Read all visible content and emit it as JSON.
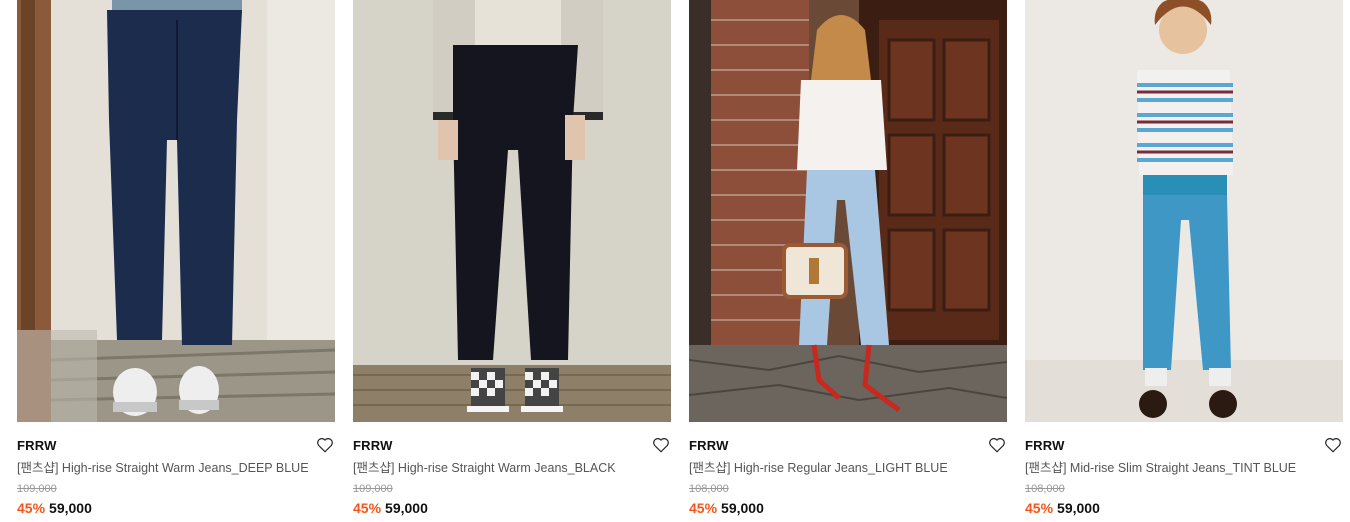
{
  "products": [
    {
      "brand": "FRRW",
      "name": "[팬츠샵] High-rise Straight Warm Jeans_DEEP BLUE",
      "original_price": "109,000",
      "discount": "45%",
      "price": "59,000",
      "image": "model-deep-blue-jeans-white-sneakers"
    },
    {
      "brand": "FRRW",
      "name": "[팬츠샵] High-rise Straight Warm Jeans_BLACK",
      "original_price": "109,000",
      "discount": "45%",
      "price": "59,000",
      "image": "model-black-jeans-checkered-slip-ons"
    },
    {
      "brand": "FRRW",
      "name": "[팬츠샵] High-rise Regular Jeans_LIGHT BLUE",
      "original_price": "108,000",
      "discount": "45%",
      "price": "59,000",
      "image": "model-light-blue-jeans-brick-wall"
    },
    {
      "brand": "FRRW",
      "name": "[팬츠샵] Mid-rise Slim Straight Jeans_TINT BLUE",
      "original_price": "108,000",
      "discount": "45%",
      "price": "59,000",
      "image": "model-tint-blue-jeans-striped-sweater"
    }
  ],
  "icons": {
    "wishlist": "heart-outline-icon"
  },
  "colors": {
    "discount": "#f2561d",
    "original_price": "#999999",
    "name": "#555555",
    "brand": "#111111"
  }
}
